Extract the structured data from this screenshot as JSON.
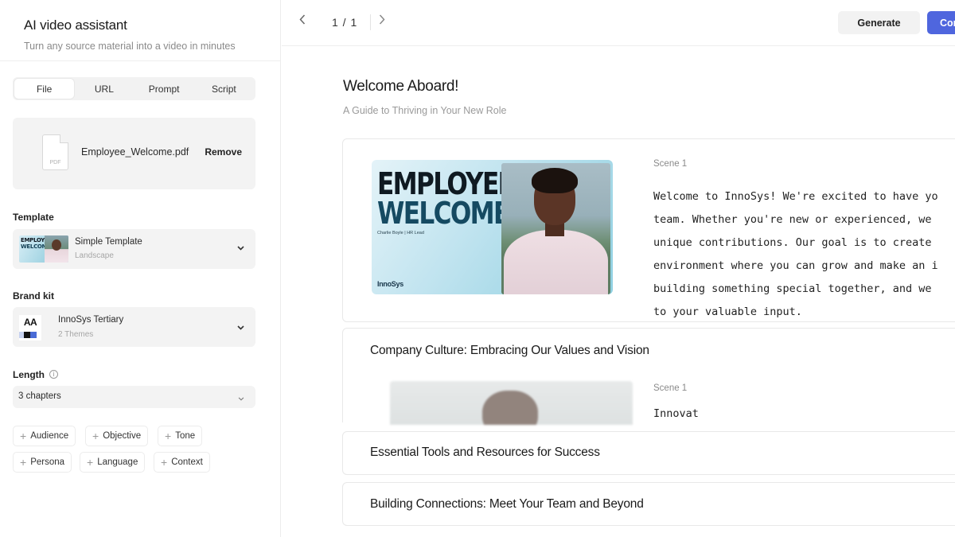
{
  "sidebar": {
    "title": "AI video assistant",
    "subtitle": "Turn any source material into a video in minutes",
    "source_tabs": [
      {
        "label": "File",
        "active": true
      },
      {
        "label": "URL",
        "active": false
      },
      {
        "label": "Prompt",
        "active": false
      },
      {
        "label": "Script",
        "active": false
      }
    ],
    "file": {
      "icon": "pdf-file-icon",
      "icon_text": "PDF",
      "name": "Employee_Welcome.pdf",
      "remove_label": "Remove"
    },
    "template": {
      "label": "Template",
      "name": "Simple Template",
      "sub": "Landscape",
      "thumb_line1": "EMPLOYEE",
      "thumb_line2": "WELCOME"
    },
    "brand_kit": {
      "label": "Brand kit",
      "name": "InnoSys Tertiary",
      "sub": "2 Themes",
      "thumb_text": "AA"
    },
    "length": {
      "label": "Length",
      "info_icon": "info-icon",
      "value": "3 chapters"
    },
    "options": [
      "Audience",
      "Objective",
      "Tone",
      "Persona",
      "Language",
      "Context"
    ]
  },
  "topbar": {
    "page_indicator": "1 / 1",
    "generate_label": "Generate",
    "continue_label": "Con"
  },
  "document": {
    "title": "Welcome Aboard!",
    "subtitle": "A Guide to Thriving in Your New Role",
    "scene1": {
      "scene_label": "Scene 1",
      "thumb_line1": "EMPLOYEE",
      "thumb_line2": "WELCOME",
      "thumb_caption": "Charlie Boyle | HR Lead",
      "thumb_logo": "InnoSys",
      "script_lines": [
        "Welcome to InnoSys! We're excited to have yo",
        "team. Whether you're new or experienced, we",
        "unique contributions. Our goal is to create",
        "environment where you can grow and make an i",
        "building something special together, and we",
        "to your valuable input."
      ]
    },
    "chapters": [
      {
        "title": "Company Culture: Embracing Our Values and Vision",
        "scene_label": "Scene 1",
        "script_preview": "Innovat"
      },
      {
        "title": "Essential Tools and Resources for Success"
      },
      {
        "title": "Building Connections: Meet Your Team and Beyond"
      }
    ]
  },
  "colors": {
    "accent": "#4f66de",
    "panel_bg": "#f3f3f3"
  }
}
